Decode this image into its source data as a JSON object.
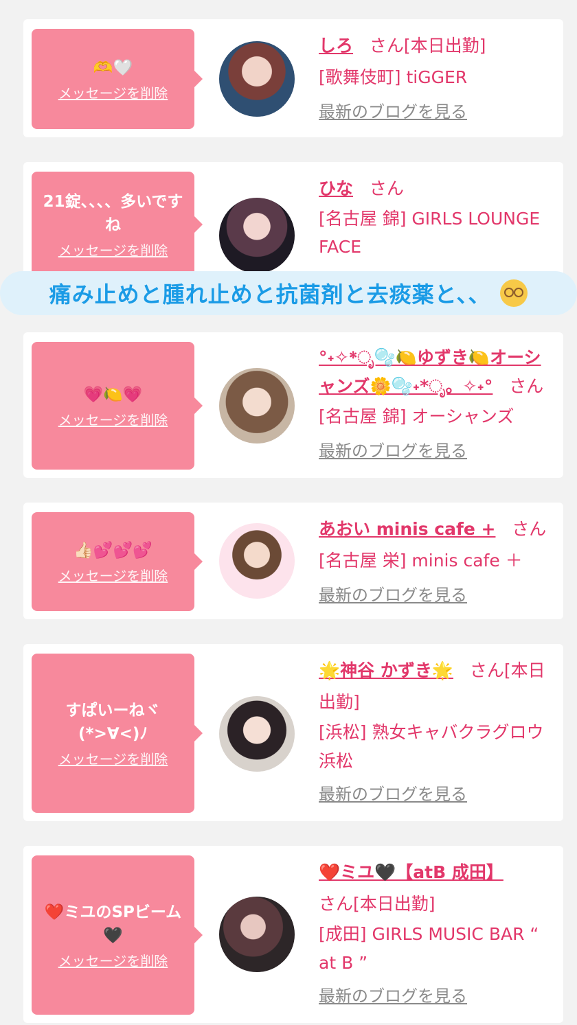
{
  "delete_label": "メッセージを削除",
  "blog_label": "最新のブログを見る",
  "san": "さん",
  "banner": {
    "text": "痛み止めと腫れ止めと抗菌剤と去痰薬と、、",
    "emoji_icon": "dizzy-face-emoji"
  },
  "cards": [
    {
      "message": "🫶🤍",
      "name": "しろ",
      "suffix": "さん[本日出勤]",
      "shop": "[歌舞伎町] tiGGER",
      "blog": "最新のブログを見る"
    },
    {
      "message": "21錠、、、、多いですね",
      "name": "ひな",
      "suffix": "さん",
      "shop": "[名古屋 錦] GIRLS LOUNGE FACE",
      "blog": ""
    },
    {
      "message": "💗🍋💗",
      "name": "°˖✧*ೃ🫧🍋ゆずき🍋オーシャンズ🌼🫧˖*ೃ。✧˖°",
      "suffix": "さん",
      "shop": "[名古屋 錦] オーシャンズ",
      "blog": "最新のブログを見る"
    },
    {
      "message": "👍🏻💕💕💕",
      "name": "あおい minis cafe +",
      "suffix": "さん",
      "shop": "[名古屋 栄] minis cafe ＋",
      "blog": "最新のブログを見る"
    },
    {
      "message": "すぱいーねヾ(*>∀<)ﾉ",
      "name": "🌟神谷 かずき🌟",
      "suffix": "さん[本日出勤]",
      "shop": "[浜松] 熟女キャバクラグロウ 浜松",
      "blog": "最新のブログを見る"
    },
    {
      "message": "❤️ミユのSPビーム🖤",
      "name": "❤️ミユ🖤【atB 成田】",
      "suffix": "さん[本日出勤]",
      "shop": "[成田] GIRLS MUSIC BAR “ at B ”",
      "blog": "最新のブログを見る"
    }
  ],
  "colors": {
    "pink": "#f7899c",
    "accent": "#e2376a",
    "banner_text": "#1a9be6"
  }
}
